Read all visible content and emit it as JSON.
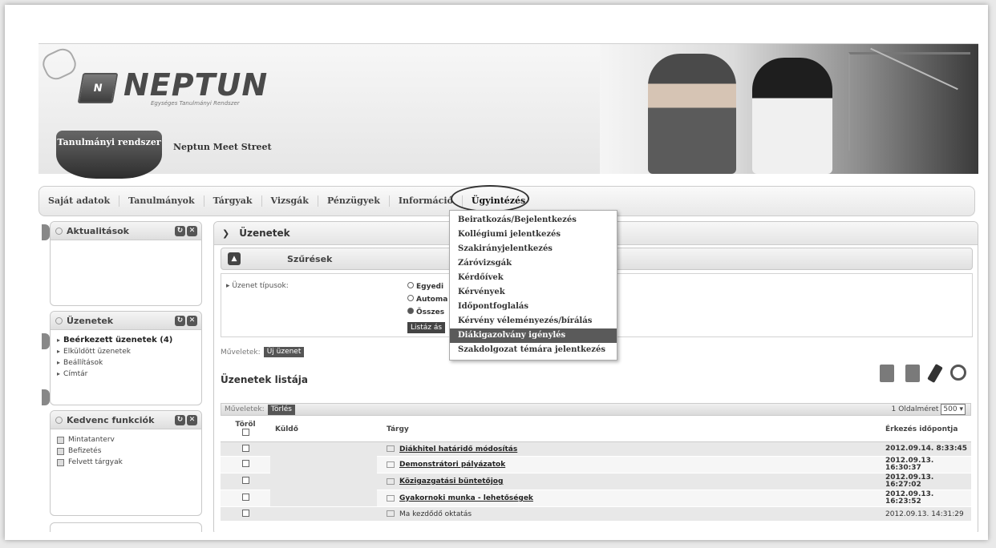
{
  "brand": {
    "name": "NEPTUN",
    "tagline": "Egységes Tanulmányi Rendszer"
  },
  "system_tabs": {
    "active": "Tanulmányi rendszer",
    "other": "Neptun Meet Street"
  },
  "nav": {
    "items": [
      "Saját adatok",
      "Tanulmányok",
      "Tárgyak",
      "Vizsgák",
      "Pénzügyek",
      "Információ",
      "Ügyintézés"
    ]
  },
  "dropdown": {
    "items": [
      "Beiratkozás/Bejelentkezés",
      "Kollégiumi jelentkezés",
      "Szakirányjelentkezés",
      "Záróvizsgák",
      "Kérdőívek",
      "Kérvények",
      "Időpontfoglalás",
      "Kérvény véleményezés/bírálás",
      "Diákigazolvány igénylés",
      "Szakdolgozat témára jelentkezés"
    ],
    "active_index": 8
  },
  "sidebar": {
    "aktualitasok": {
      "title": "Aktualitások"
    },
    "uzenetek": {
      "title": "Üzenetek",
      "items": [
        "Beérkezett üzenetek (4)",
        "Elküldött üzenetek",
        "Beállítások",
        "Címtár"
      ]
    },
    "kedvenc": {
      "title": "Kedvenc funkciók",
      "items": [
        "Mintatanterv",
        "Befizetés",
        "Felvett tárgyak"
      ]
    }
  },
  "main": {
    "title": "Üzenetek",
    "filters": {
      "title": "Szűrések",
      "type_label": "Üzenet típusok:",
      "options": [
        "Egyedi",
        "Automa",
        "Összes"
      ],
      "list_button": "Listáz ás"
    },
    "ops_label": "Műveletek:",
    "new_message": "Új üzenet",
    "list_title": "Üzenetek listája",
    "grid_ops_label": "Műveletek:",
    "delete_button": "Törlés",
    "page_number": "1",
    "page_size_label": "Oldalméret",
    "page_size_value": "500",
    "columns": {
      "delete": "Töröl",
      "sender": "Küldő",
      "subject": "Tárgy",
      "date": "Érkezés időpontja"
    },
    "rows": [
      {
        "subject": "Diákhitel határidő módosítás",
        "date": "2012.09.14. 8:33:45"
      },
      {
        "subject": "Demonstrátori pályázatok",
        "date": "2012.09.13. 16:30:37"
      },
      {
        "subject": "Közigazgatási büntetőjog",
        "date": "2012.09.13. 16:27:02"
      },
      {
        "subject": "Gyakornoki munka - lehetőségek",
        "date": "2012.09.13. 16:23:52"
      },
      {
        "subject": "Ma kezdődő oktatás",
        "date": "2012.09.13. 14:31:29"
      }
    ]
  }
}
